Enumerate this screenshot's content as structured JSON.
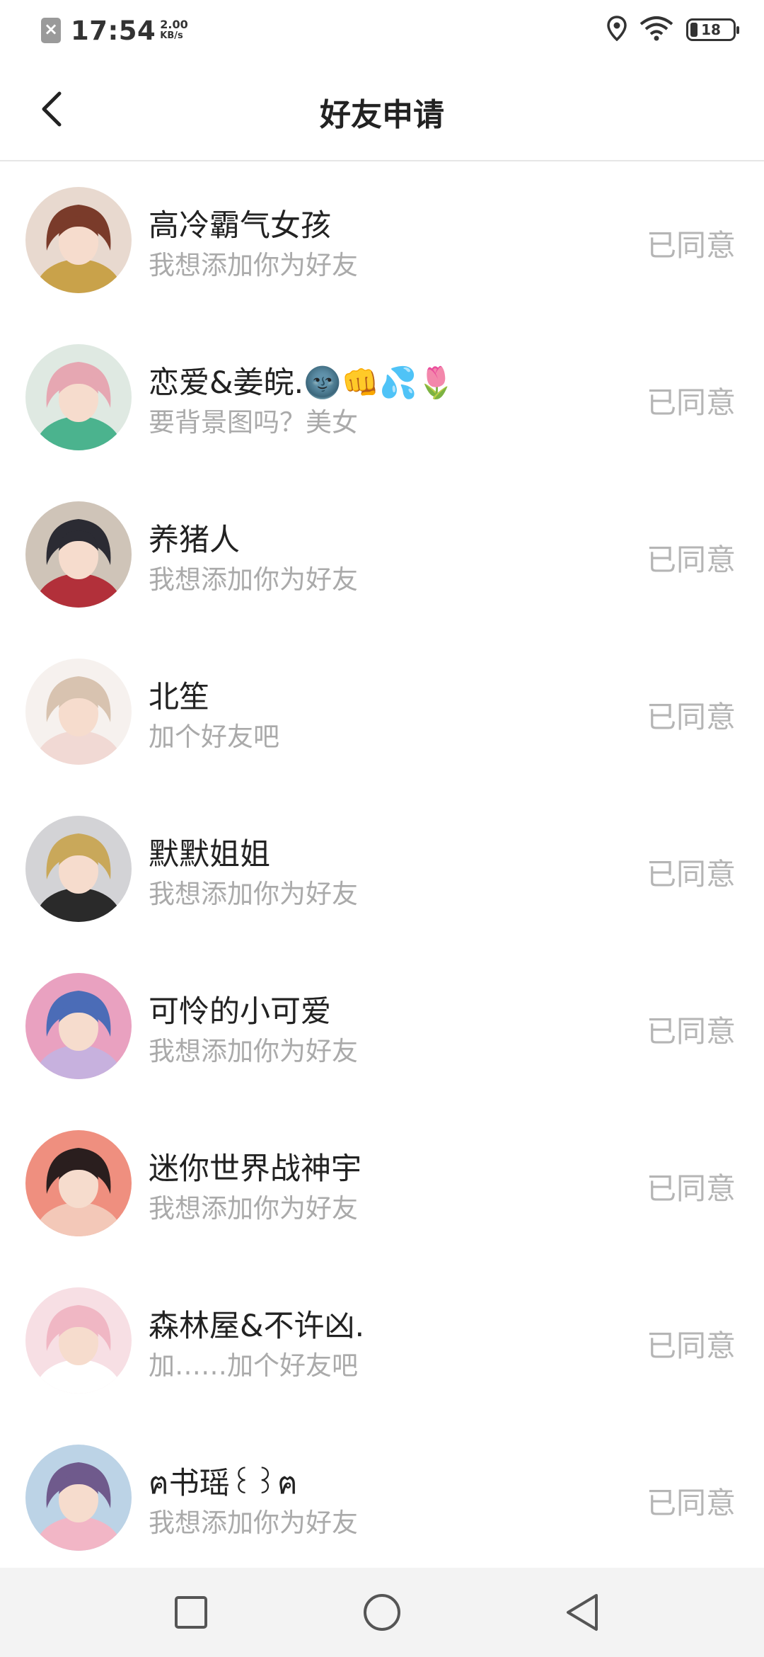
{
  "status_bar": {
    "time": "17:54",
    "net_speed_value": "2.00",
    "net_speed_unit": "KB/s",
    "battery_level": "18",
    "battery_fraction": 0.18
  },
  "header": {
    "title": "好友申请"
  },
  "requests": [
    {
      "name": "高冷霸气女孩",
      "message": "我想添加你为好友",
      "status": "已同意",
      "avatar_colors": [
        "#e8d9cf",
        "#7a3b2a",
        "#c9a24a"
      ]
    },
    {
      "name": "恋爱&姜皖.🌚👊💦🌷",
      "message": "要背景图吗？美女",
      "status": "已同意",
      "avatar_colors": [
        "#dfe9e2",
        "#e6a7b2",
        "#4bb38e"
      ]
    },
    {
      "name": "养猪人",
      "message": "我想添加你为好友",
      "status": "已同意",
      "avatar_colors": [
        "#cfc4b8",
        "#2b2b33",
        "#b2303a"
      ]
    },
    {
      "name": "北笙",
      "message": "加个好友吧",
      "status": "已同意",
      "avatar_colors": [
        "#f6f1ee",
        "#d8c3b0",
        "#f1d9d4"
      ]
    },
    {
      "name": "默默姐姐",
      "message": "我想添加你为好友",
      "status": "已同意",
      "avatar_colors": [
        "#d3d3d6",
        "#c9a85a",
        "#2a2a2a"
      ]
    },
    {
      "name": "可怜的小可爱",
      "message": "我想添加你为好友",
      "status": "已同意",
      "avatar_colors": [
        "#e9a1c0",
        "#4b6cb7",
        "#c7b1de"
      ]
    },
    {
      "name": "迷你世界战神宇",
      "message": "我想添加你为好友",
      "status": "已同意",
      "avatar_colors": [
        "#ef8f7f",
        "#2a1e1e",
        "#f3c8b8"
      ]
    },
    {
      "name": "森林屋&不许凶.",
      "message": "加……加个好友吧",
      "status": "已同意",
      "avatar_colors": [
        "#f7dfe4",
        "#f0b7c4",
        "#ffffff"
      ]
    },
    {
      "name": "ฅ书瑶꒰꒱ฅ",
      "message": "我想添加你为好友",
      "status": "已同意",
      "avatar_colors": [
        "#bcd3e6",
        "#6f5a8c",
        "#f2b6c6"
      ]
    }
  ]
}
